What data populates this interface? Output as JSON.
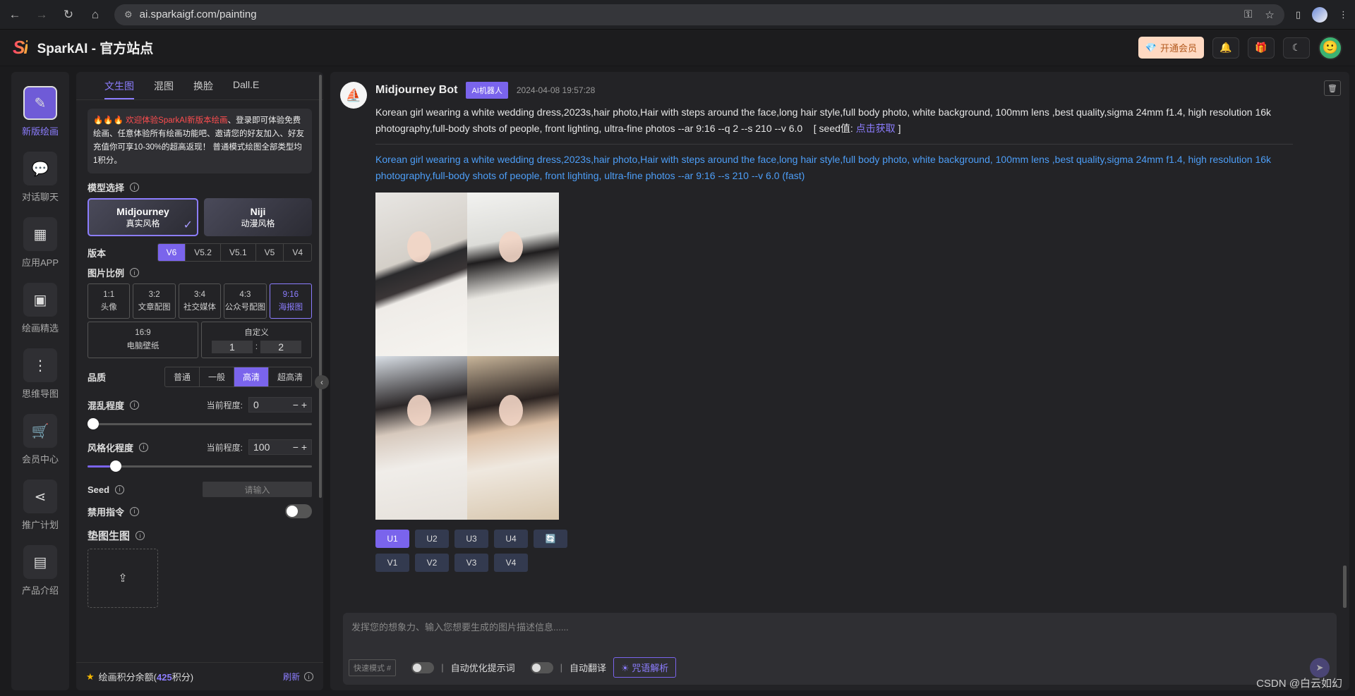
{
  "browser": {
    "url": "ai.sparkaigf.com/painting"
  },
  "header": {
    "logo": "Si",
    "title": "SparkAI - 官方站点",
    "vip_label": "开通会员"
  },
  "leftnav": [
    {
      "label": "新版绘画",
      "icon": "edit-icon",
      "glyph": "✎"
    },
    {
      "label": "对话聊天",
      "icon": "chat-icon",
      "glyph": "💬"
    },
    {
      "label": "应用APP",
      "icon": "grid-icon",
      "glyph": "▦"
    },
    {
      "label": "绘画精选",
      "icon": "image-icon",
      "glyph": "▣"
    },
    {
      "label": "思维导图",
      "icon": "mindmap-icon",
      "glyph": "⋮"
    },
    {
      "label": "会员中心",
      "icon": "cart-icon",
      "glyph": "🛒"
    },
    {
      "label": "推广计划",
      "icon": "share-icon",
      "glyph": "⋖"
    },
    {
      "label": "产品介绍",
      "icon": "product-icon",
      "glyph": "▤"
    }
  ],
  "panel": {
    "tabs": [
      "文生图",
      "混图",
      "换脸",
      "Dall.E"
    ],
    "notice_flames": "🔥🔥🔥",
    "notice_hl": "欢迎体验SparkAI新版本绘画",
    "notice_text": "、登录即可体验免费绘画、任意体验所有绘画功能吧、邀请您的好友加入、好友充值你可享10-30%的超高返现！ 普通模式绘图全部类型均1积分。",
    "model_label": "模型选择",
    "models": [
      {
        "name": "Midjourney",
        "desc": "真实风格"
      },
      {
        "name": "Niji",
        "desc": "动漫风格"
      }
    ],
    "version_label": "版本",
    "versions": [
      "V6",
      "V5.2",
      "V5.1",
      "V5",
      "V4"
    ],
    "ratio_label": "图片比例",
    "ratios": [
      {
        "r": "1:1",
        "d": "头像"
      },
      {
        "r": "3:2",
        "d": "文章配图"
      },
      {
        "r": "3:4",
        "d": "社交媒体"
      },
      {
        "r": "4:3",
        "d": "公众号配图"
      },
      {
        "r": "9:16",
        "d": "海报图"
      }
    ],
    "ratio_wide": {
      "r": "16:9",
      "d": "电脑壁纸"
    },
    "custom": {
      "label": "自定义",
      "a": "1",
      "sep": ":",
      "b": "2"
    },
    "quality_label": "品质",
    "qualities": [
      "普通",
      "一般",
      "高清",
      "超高清"
    ],
    "chaos_label": "混乱程度",
    "current_label": "当前程度:",
    "chaos_value": "0",
    "chaos_fraction": 0,
    "stylize_label": "风格化程度",
    "stylize_value": "100",
    "stylize_fraction": 0.1,
    "seed_label": "Seed",
    "seed_placeholder": "请输入",
    "noprompt_label": "禁用指令",
    "ref_label": "垫图生图",
    "footer_label": "绘画积分余额(",
    "footer_num": "425",
    "footer_unit": "积分)",
    "refresh": "刷新"
  },
  "message": {
    "bot_name": "Midjourney Bot",
    "badge": "AI机器人",
    "time": "2024-04-08 19:57:28",
    "prompt": "Korean girl wearing a white wedding dress,2023s,hair photo,Hair with steps around the face,long hair style,full body photo, white background, 100mm lens ,best quality,sigma 24mm f1.4, high resolution 16k photography,full-body shots of people, front lighting, ultra-fine photos --ar 9:16 --q 2 --s 210 --v 6.0",
    "seed_prefix": "[ seed值:",
    "seed_link": "点击获取",
    "seed_suffix": "]",
    "prompt2": "Korean girl wearing a white wedding dress,2023s,hair photo,Hair with steps around the face,long hair style,full body photo, white background, 100mm lens ,best quality,sigma 24mm f1.4, high resolution 16k photography,full-body shots of people, front lighting, ultra-fine photos --ar 9:16 --s 210 --v 6.0  (fast)",
    "u_buttons": [
      "U1",
      "U2",
      "U3",
      "U4"
    ],
    "v_buttons": [
      "V1",
      "V2",
      "V3",
      "V4"
    ]
  },
  "input": {
    "placeholder": "发挥您的想象力、输入您想要生成的图片描述信息......",
    "quick": "快速模式 #",
    "opt1": "自动优化提示词",
    "opt2": "自动翻译",
    "parse": "咒语解析"
  },
  "watermark": "CSDN @白云如幻"
}
